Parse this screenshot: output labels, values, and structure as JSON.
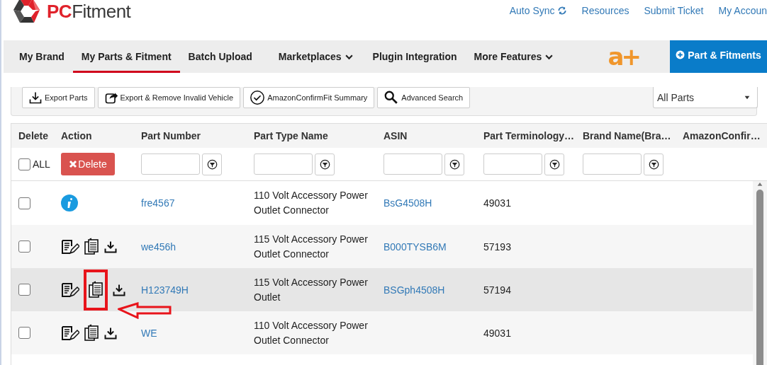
{
  "brand": {
    "name_accent": "PC",
    "name_rest": "Fitment"
  },
  "top_links": [
    {
      "label": "Auto Sync",
      "kind": "sync"
    },
    {
      "label": "Resources",
      "kind": "plain"
    },
    {
      "label": "Submit Ticket",
      "kind": "plain"
    },
    {
      "label": "My Accoun",
      "kind": "plain"
    }
  ],
  "nav": [
    {
      "label": "My Brand",
      "selected": false,
      "dropdown": false
    },
    {
      "label": "My Parts & Fitment",
      "selected": true,
      "dropdown": false
    },
    {
      "label": "Batch Upload",
      "selected": false,
      "dropdown": false
    },
    {
      "label": "Marketplaces",
      "selected": false,
      "dropdown": true
    },
    {
      "label": "Plugin Integration",
      "selected": false,
      "dropdown": false
    },
    {
      "label": "More Features",
      "selected": false,
      "dropdown": true
    }
  ],
  "aplus_logo": {
    "text": "a+"
  },
  "add_button": {
    "label": "Part & Fitments"
  },
  "toolbar": [
    {
      "label": "Export Parts",
      "kind": "export"
    },
    {
      "label": "Export & Remove Invalid Vehicle",
      "kind": "share"
    },
    {
      "label": "AmazonConfirmFit Summary",
      "kind": "check"
    },
    {
      "label": "Advanced Search",
      "kind": "search"
    }
  ],
  "filter_select": {
    "value": "All Parts"
  },
  "table": {
    "columns": [
      {
        "label": "Delete",
        "kind": "all"
      },
      {
        "label": "Action",
        "kind": "delete"
      },
      {
        "label": "Part Number",
        "kind": "input"
      },
      {
        "label": "Part Type Name",
        "kind": "input"
      },
      {
        "label": "ASIN",
        "kind": "input"
      },
      {
        "label": "Part Terminology…",
        "kind": "input"
      },
      {
        "label": "Brand Name(Bra…",
        "kind": "input"
      },
      {
        "label": "AmazonConfir…",
        "kind": "none"
      }
    ],
    "all_label": "ALL",
    "all_checked": false,
    "delete_label": "Delete",
    "rows": [
      {
        "checked": false,
        "kind": "info",
        "part_number": "fre4567",
        "part_type": "110 Volt Accessory Power Outlet Connector",
        "asin": "BsG4508H",
        "terminology": "49031",
        "hovered": false,
        "highlighted": false
      },
      {
        "checked": false,
        "kind": "actions",
        "part_number": "we456h",
        "part_type": "115 Volt Accessory Power Outlet Connector",
        "asin": "B000TYSB6M",
        "terminology": "57193",
        "hovered": false,
        "highlighted": false
      },
      {
        "checked": false,
        "kind": "actions",
        "part_number": "H123749H",
        "part_type": "115 Volt Accessory Power Outlet",
        "asin": "BSGph4508H",
        "terminology": "57194",
        "hovered": true,
        "highlighted": true
      },
      {
        "checked": false,
        "kind": "actions",
        "part_number": "WE",
        "part_type": "110 Volt Accessory Power Outlet Connector",
        "asin": "",
        "terminology": "49031",
        "hovered": false,
        "highlighted": false
      }
    ]
  }
}
